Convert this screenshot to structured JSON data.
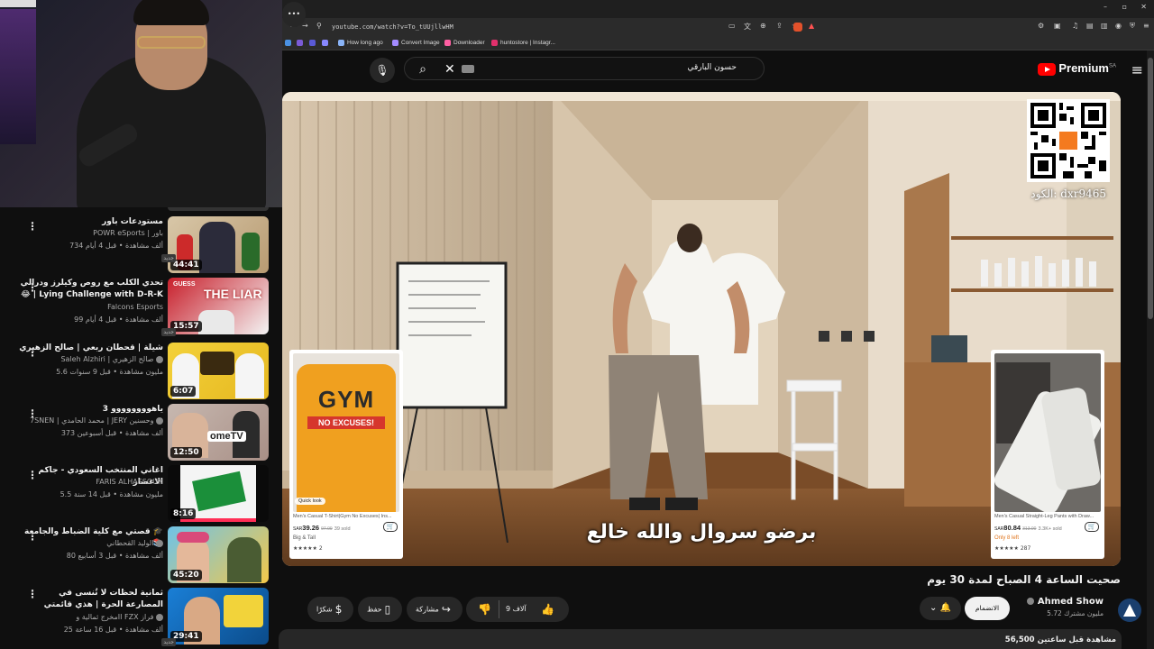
{
  "browser": {
    "url": "youtube.com/watch?v=To_tUUjllwHM",
    "bookmarks": [
      "How long ago",
      "Convert Image",
      "Downloader",
      "huntostore | Instagr..."
    ],
    "window_controls": [
      "–",
      "▫",
      "✕"
    ]
  },
  "youtube": {
    "logo_text": "Premium",
    "logo_region": "SA",
    "search_query": "حسون البارقي"
  },
  "video": {
    "subtitle": "برضو سروال والله خالع",
    "qr_code_label": "الكود: dxr9465",
    "title": "صحيت الساعة 4 الصباح لمدة 30 يوم",
    "views": "56,500 مشاهدة",
    "time_ago": "قبل ساعتين"
  },
  "products": {
    "left": {
      "shirt_text_1": "GYM",
      "shirt_text_2": "NO EXCUSES!",
      "quick_look": "Quick look",
      "name": "Men's Casual T-Shirt|Gym No Excuses| Ins...",
      "currency": "SAR",
      "price": "39.26",
      "old_price": "97.09",
      "sold": "39 sold",
      "tag": "Big & Tall",
      "stars": "★★★★★",
      "rating_count": "2"
    },
    "right": {
      "name": "Men's Casual Straight-Leg Pants with Draw...",
      "currency": "SAR",
      "price": "80.84",
      "old_price": "313.00",
      "sold": "3.3K+ sold",
      "tag": "Only 8 left",
      "stars": "★★★★★",
      "rating_count": "287"
    }
  },
  "channel": {
    "name": "Ahmed Show",
    "subscribers": "5.72 مليون مشترك",
    "subscribe_label": "الانضمام"
  },
  "actions": {
    "like_count": "9 آلاف",
    "share_label": "مشاركة",
    "save_label": "حفظ",
    "thanks_label": "شكرًا",
    "more": "•••"
  },
  "recommendations": [
    {
      "title": "مستودعات باور",
      "channel": "POWR eSports | باور",
      "meta": "734 ألف مشاهدة • قبل 4 أيام",
      "duration": "44:41",
      "new": "جديد"
    },
    {
      "title": "تحدي الكلب مع روص وكيلرز ودرالي 😂 | Lying Challenge with D-R-K",
      "channel": "Falcons Esports",
      "meta": "99 ألف مشاهدة • قبل 4 أيام",
      "duration": "15:57",
      "new": "جديد"
    },
    {
      "title": "شيلة | قحطان ربعي | صالح الزهيري",
      "channel": "Saleh Alzhiri | صالح الزهيري",
      "meta": "5.6 مليون مشاهدة • قبل 9 سنوات",
      "duration": "6:07"
    },
    {
      "title": "ياهوووووووو 3",
      "channel": "7SNEN | محمد الحامدي | JERY وحسنين",
      "meta": "373 ألف مشاهدة • قبل أسبوعين",
      "duration": "12:50"
    },
    {
      "title": "اغاني المنتخب السعودي - جاكم الاعصار",
      "channel": "FARIS ALHASSOUN",
      "meta": "5.5 مليون مشاهدة • قبل 14 سنة",
      "duration": "8:16"
    },
    {
      "title": "قصتي مع كلية الضباط والجامعة 🎓📚",
      "channel": "الوليد القحطاني",
      "meta": "80 ألف مشاهدة • قبل 3 أسابيع",
      "duration": "45:20"
    },
    {
      "title": "ثمانية لحظات لا تُنسى في المصارعة الحرة | هذي قائمتي",
      "channel": "مخرج ثمالية وII FZX فراز",
      "meta": "25 ألف مشاهدة • قبل 16 ساعة",
      "duration": "29:41",
      "new": "جديد"
    }
  ],
  "colors": {
    "brand": "#ff0000",
    "background": "#0f0f0f",
    "pill": "#272727"
  }
}
